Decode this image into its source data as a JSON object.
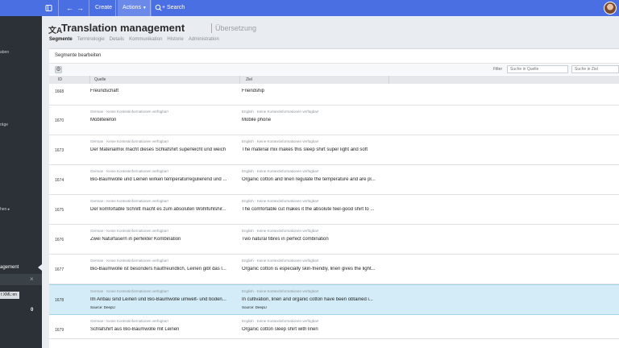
{
  "topbar": {
    "create_label": "Create",
    "actions_label": "Actions",
    "search_label": "+ Search"
  },
  "sidebar": {
    "fragments": [
      "aben",
      "räge",
      "hen ▸",
      "agement"
    ],
    "tag_label": "t XML:en",
    "count": "0"
  },
  "header": {
    "title": "Translation management",
    "subtitle": "Übersetzung",
    "tabs": [
      "Segmente",
      "Terminologie",
      "Details",
      "Kommunikation",
      "Historie",
      "Administration"
    ]
  },
  "panel": {
    "title": "Segmente bearbeiten",
    "filter_label": "Filter",
    "search_source_placeholder": "Suche in Quelle",
    "search_target_placeholder": "Suche in Ziel",
    "columns": {
      "id": "ID",
      "source": "Quelle",
      "target": "Ziel"
    }
  },
  "rows": [
    {
      "id": "1668",
      "src_lang": "",
      "src_ctx": "",
      "source": "Freundschaft",
      "tgt_lang": "",
      "tgt_ctx": "",
      "target": "Friendship",
      "source_note": "",
      "selected": false
    },
    {
      "id": "1670",
      "src_lang": "German",
      "src_ctx": "Keine Kontextinformationen verfügbar!",
      "source": "Mobiltelefon",
      "tgt_lang": "English",
      "tgt_ctx": "Keine Kontextinformationen verfügbar!",
      "target": "Mobile phone",
      "source_note": "",
      "selected": false
    },
    {
      "id": "1673",
      "src_lang": "German",
      "src_ctx": "Keine Kontextinformationen verfügbar!",
      "source": "Der Materialmix macht dieses Schlafshirt superleicht und weich",
      "tgt_lang": "English",
      "tgt_ctx": "Keine Kontextinformationen verfügbar!",
      "target": "The material mix makes this sleep shirt super light and soft",
      "source_note": "",
      "selected": false
    },
    {
      "id": "1674",
      "src_lang": "German",
      "src_ctx": "Keine Kontextinformationen verfügbar!",
      "source": "Bio-Baumwolle und Leinen wirken temperaturregulierend und ...",
      "tgt_lang": "English",
      "tgt_ctx": "Keine Kontextinformationen verfügbar!",
      "target": "Organic cotton and linen regulate the temperature and are pl...",
      "source_note": "",
      "selected": false
    },
    {
      "id": "1675",
      "src_lang": "German",
      "src_ctx": "Keine Kontextinformationen verfügbar!",
      "source": "Der komfortable Schnitt macht es zum absoluten Wohlfühlshir...",
      "tgt_lang": "English",
      "tgt_ctx": "Keine Kontextinformationen verfügbar!",
      "target": "The comfortable cut makes it the absolute feel-good shirt to ...",
      "source_note": "",
      "selected": false
    },
    {
      "id": "1676",
      "src_lang": "German",
      "src_ctx": "Keine Kontextinformationen verfügbar!",
      "source": "Zwei Naturfasern in perfekter Kombination",
      "tgt_lang": "English",
      "tgt_ctx": "Keine Kontextinformationen verfügbar!",
      "target": "Two natural fibres in perfect combination",
      "source_note": "",
      "selected": false
    },
    {
      "id": "1677",
      "src_lang": "German",
      "src_ctx": "Keine Kontextinformationen verfügbar!",
      "source": "Bio-Baumwolle ist besonders hautfreundlich, Leinen gibt das l...",
      "tgt_lang": "English",
      "tgt_ctx": "Keine Kontextinformationen verfügbar!",
      "target": "Organic cotton is especially skin-friendly, linen gives the light...",
      "source_note": "",
      "selected": false
    },
    {
      "id": "1678",
      "src_lang": "German",
      "src_ctx": "Keine Kontextinformationen verfügbar!",
      "source": "Im Anbau sind Leinen und Bio-Baumwolle umwelt- und boden...",
      "tgt_lang": "English",
      "tgt_ctx": "Keine Kontextinformationen verfügbar!",
      "target": "In cultivation, linen and organic cotton have been obtained i...",
      "source_note": "Source: DeepL!",
      "selected": true
    },
    {
      "id": "1679",
      "src_lang": "German",
      "src_ctx": "Keine Kontextinformationen verfügbar!",
      "source": "Schlafshirt aus Bio-Baumwolle mit Leinen",
      "tgt_lang": "English",
      "tgt_ctx": "Keine Kontextinformationen verfügbar!",
      "target": "Organic cotton sleep shirt with linen",
      "source_note": "",
      "selected": false
    }
  ]
}
